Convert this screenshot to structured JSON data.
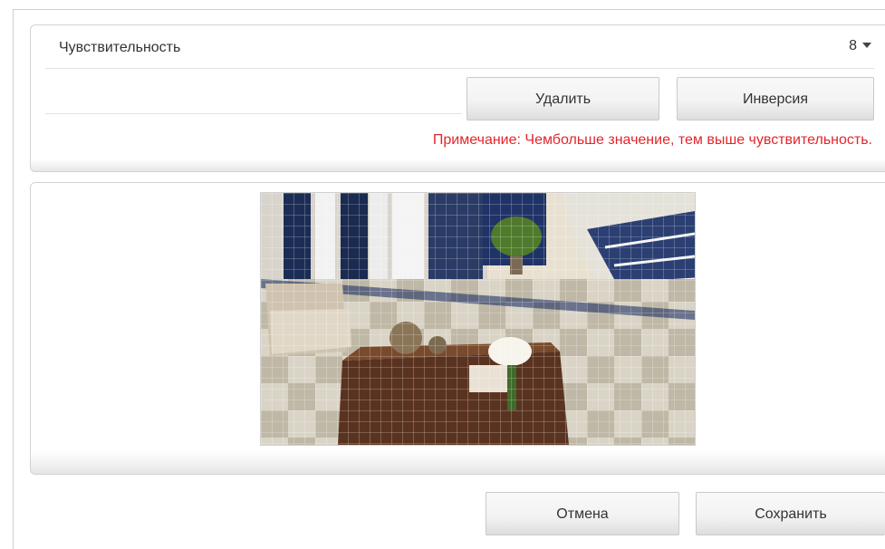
{
  "sensitivity": {
    "label": "Чувствительность",
    "value": "8"
  },
  "buttons": {
    "delete": "Удалить",
    "invert": "Инверсия",
    "cancel": "Отмена",
    "save": "Сохранить"
  },
  "note": "Примечание: Чембольше значение, тем выше чувствительность.",
  "preview": {
    "grid": "motion-detection-grid",
    "scene": "lobby-with-staircase"
  },
  "colors": {
    "note_red": "#e3262b",
    "text": "#333333"
  }
}
